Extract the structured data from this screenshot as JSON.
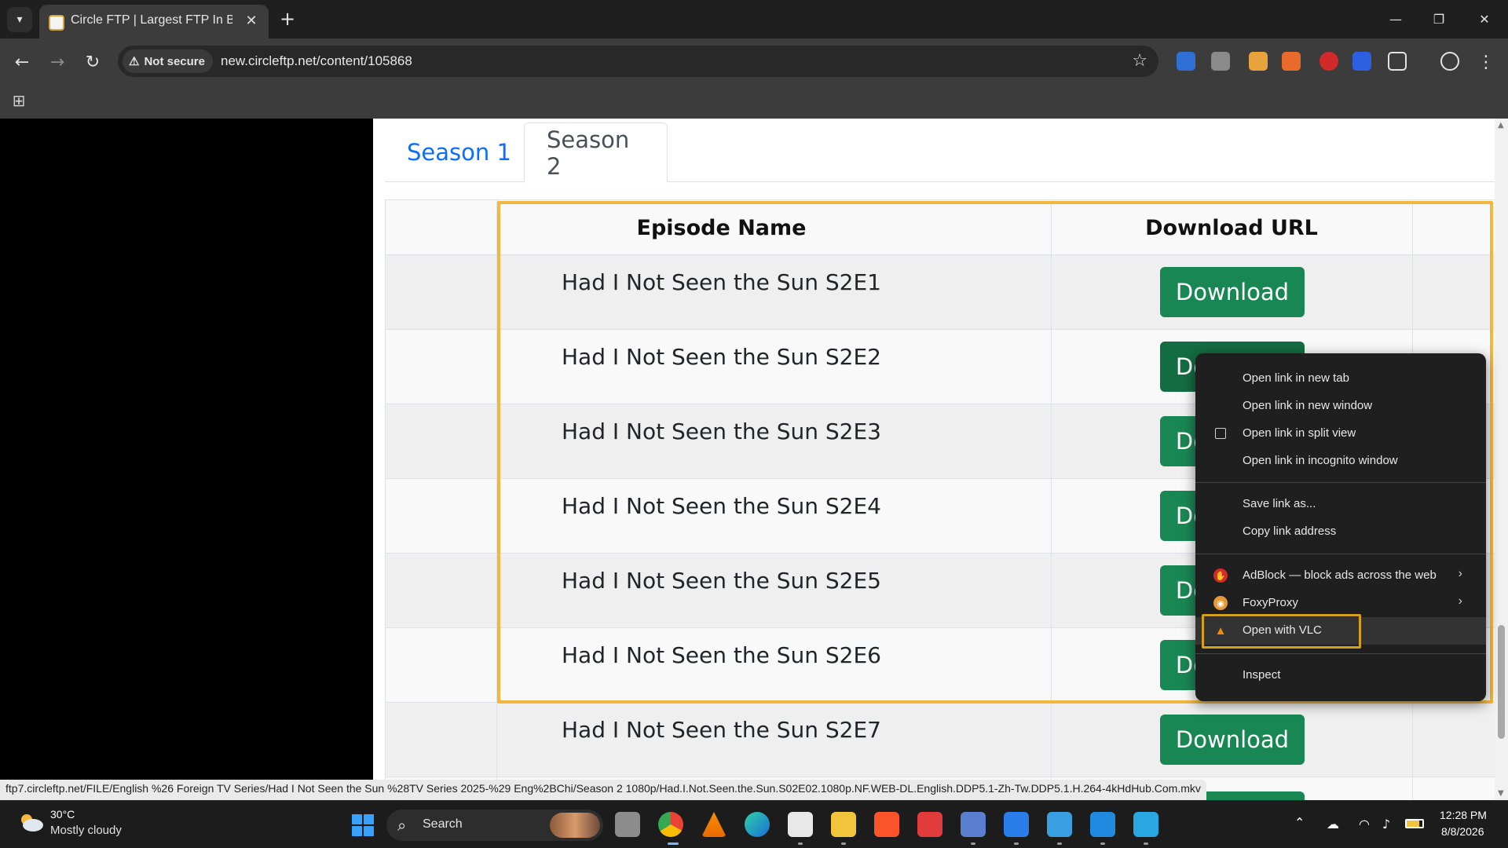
{
  "browser": {
    "tab_title": "Circle FTP | Largest FTP In Bangl",
    "close_glyph": "✕",
    "new_tab_glyph": "+",
    "security_label": "Not secure",
    "url": "new.circleftp.net/content/105868"
  },
  "page": {
    "season_tabs": [
      {
        "label": "Season 1"
      },
      {
        "label": "Season 2"
      }
    ],
    "table": {
      "headers": [
        "Episode Name",
        "Download URL"
      ],
      "rows": [
        {
          "name": "Had I Not Seen the Sun S2E1",
          "button": "Download"
        },
        {
          "name": "Had I Not Seen the Sun S2E2",
          "button": "Download"
        },
        {
          "name": "Had I Not Seen the Sun S2E3",
          "button": "Download"
        },
        {
          "name": "Had I Not Seen the Sun S2E4",
          "button": "Download"
        },
        {
          "name": "Had I Not Seen the Sun S2E5",
          "button": "Download"
        },
        {
          "name": "Had I Not Seen the Sun S2E6",
          "button": "Download"
        },
        {
          "name": "Had I Not Seen the Sun S2E7",
          "button": "Download"
        }
      ]
    },
    "status_url": "ftp7.circleftp.net/FILE/English %26 Foreign TV Series/Had I Not Seen the Sun %28TV Series 2025-%29 Eng%2BChi/Season 2 1080p/Had.I.Not.Seen.the.Sun.S02E02.1080p.NF.WEB-DL.English.DDP5.1-Zh-Tw.DDP5.1.H.264-4kHdHub.Com.mkv"
  },
  "context_menu": {
    "items": [
      {
        "label": "Open link in new tab"
      },
      {
        "label": "Open link in new window"
      },
      {
        "label": "Open link in split view",
        "icon": "split-view-icon"
      },
      {
        "label": "Open link in incognito window"
      },
      {
        "label": "Save link as..."
      },
      {
        "label": "Copy link address"
      },
      {
        "label": "AdBlock — block ads across the web",
        "icon": "adblock-icon",
        "submenu": true
      },
      {
        "label": "FoxyProxy",
        "icon": "foxyproxy-icon",
        "submenu": true
      },
      {
        "label": "Open with VLC",
        "icon": "vlc-icon"
      },
      {
        "label": "Inspect"
      }
    ]
  },
  "taskbar": {
    "weather_temp": "30°C",
    "weather_desc": "Mostly cloudy",
    "search_label": "Search",
    "time": "12:28 PM",
    "date": "8/8/2026"
  },
  "colors": {
    "download_button": "#198754",
    "highlight": "#f4b73e",
    "active_link": "#0d6efd"
  }
}
